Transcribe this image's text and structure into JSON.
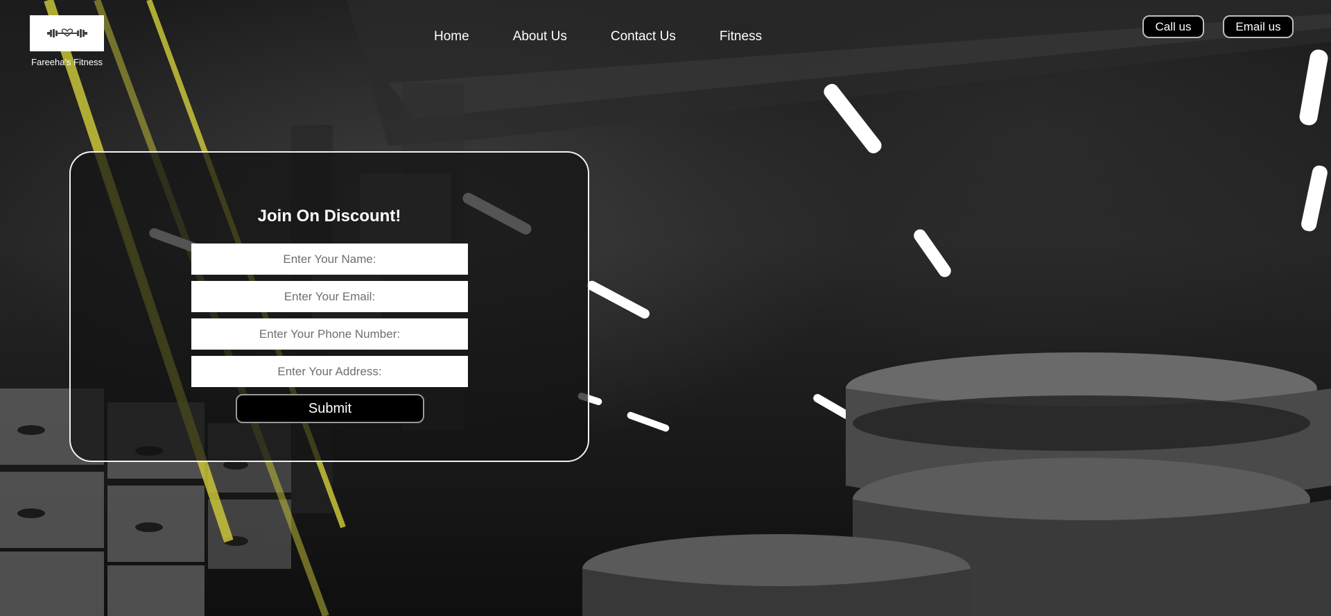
{
  "brand": {
    "name": "Fareeha's Fitness",
    "logo_icon": "dumbbell-heart-icon"
  },
  "nav": {
    "items": [
      "Home",
      "About Us",
      "Contact Us",
      "Fitness"
    ]
  },
  "header_buttons": {
    "call": "Call us",
    "email": "Email us"
  },
  "form": {
    "title": "Join On Discount!",
    "fields": [
      {
        "placeholder": "Enter Your Name:",
        "value": ""
      },
      {
        "placeholder": "Enter Your Email:",
        "value": ""
      },
      {
        "placeholder": "Enter Your Phone Number:",
        "value": ""
      },
      {
        "placeholder": "Enter Your Address:",
        "value": ""
      }
    ],
    "submit_label": "Submit"
  },
  "background": {
    "description_icon": "gym-background-image",
    "accent_color": "#d9d43a"
  }
}
